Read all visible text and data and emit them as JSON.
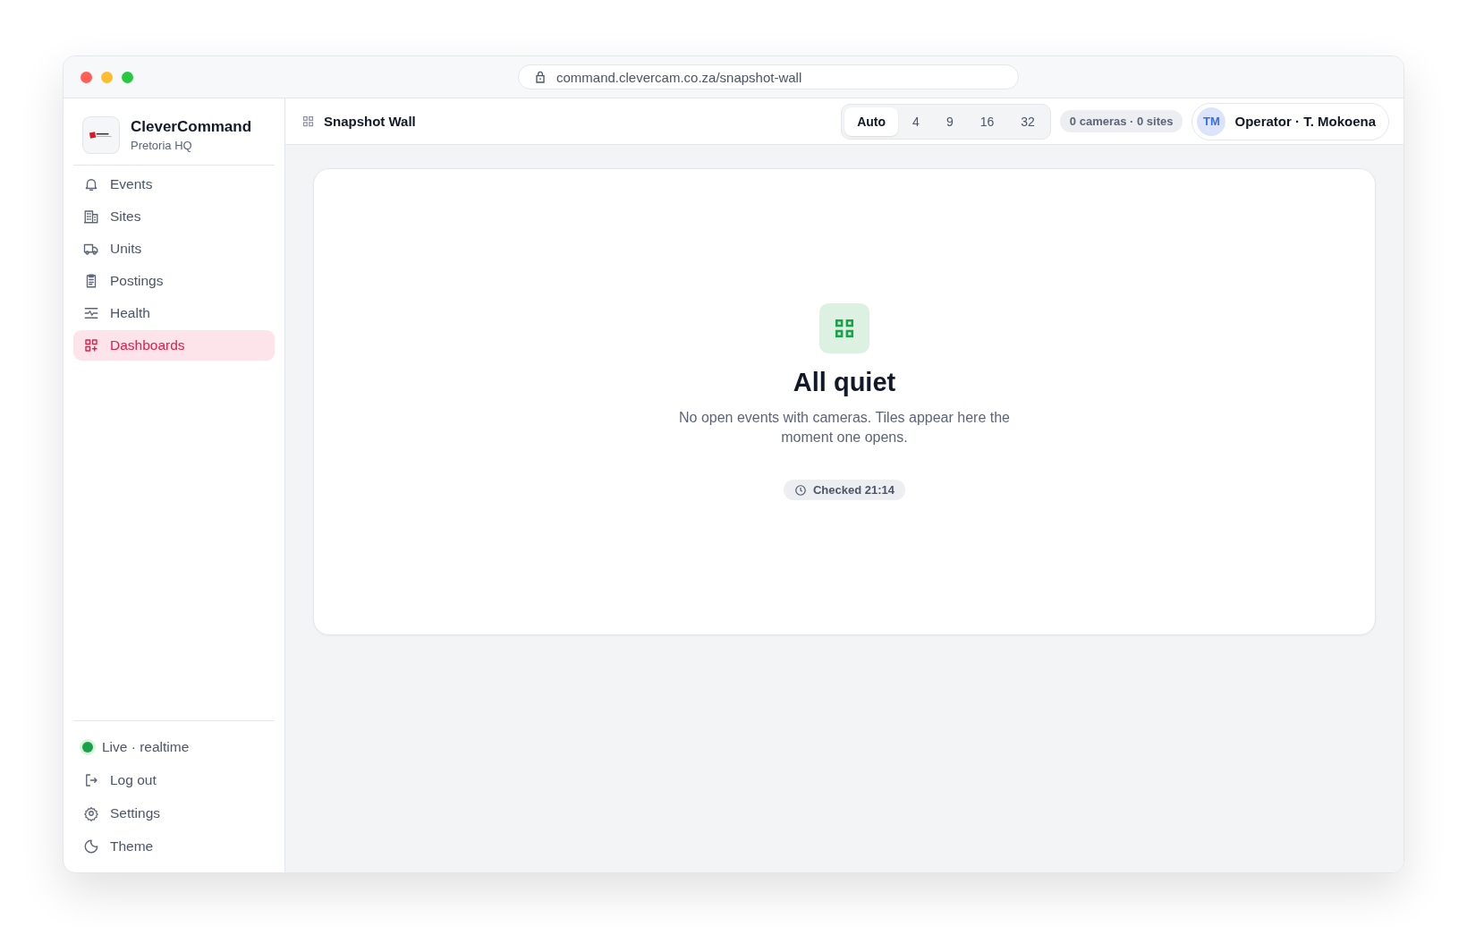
{
  "browser": {
    "url": "command.clevercam.co.za/snapshot-wall"
  },
  "sidebar": {
    "brand": {
      "name": "CleverCommand",
      "subtitle": "Pretoria HQ"
    },
    "items": [
      {
        "label": "Events",
        "kind": "bell",
        "selected": false
      },
      {
        "label": "Sites",
        "kind": "building",
        "selected": false
      },
      {
        "label": "Units",
        "kind": "truck",
        "selected": false
      },
      {
        "label": "Postings",
        "kind": "clipboard",
        "selected": false
      },
      {
        "label": "Health",
        "kind": "pulse",
        "selected": false
      },
      {
        "label": "Dashboards",
        "kind": "grid-plus",
        "selected": true
      }
    ],
    "status": {
      "label": "Live · realtime",
      "color": "#16a34a"
    },
    "footer_items": [
      {
        "label": "Log out",
        "kind": "logout"
      },
      {
        "label": "Settings",
        "kind": "gear"
      },
      {
        "label": "Theme",
        "kind": "moon"
      }
    ]
  },
  "header": {
    "title": "Snapshot Wall",
    "layouts": [
      {
        "label": "Auto",
        "selected": true
      },
      {
        "label": "4",
        "selected": false
      },
      {
        "label": "9",
        "selected": false
      },
      {
        "label": "16",
        "selected": false
      },
      {
        "label": "32",
        "selected": false
      }
    ],
    "count": "0 cameras · 0 sites",
    "user": {
      "initials": "TM",
      "name": "Operator · T. Mokoena"
    }
  },
  "empty_state": {
    "title": "All quiet",
    "message": "No open events with cameras. Tiles appear here the moment one opens.",
    "checked": "Checked 21:14"
  }
}
